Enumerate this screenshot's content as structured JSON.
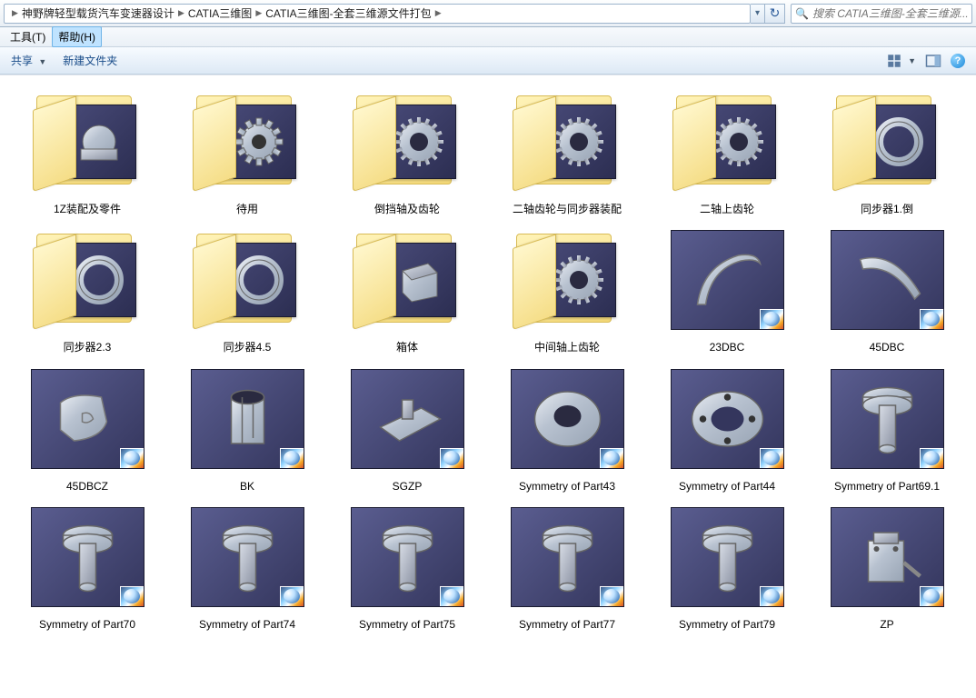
{
  "breadcrumb": {
    "seg1": "神野牌轻型载货汽车变速器设计",
    "seg2": "CATIA三维图",
    "seg3": "CATIA三维图-全套三维源文件打包"
  },
  "search": {
    "placeholder": "搜索 CATIA三维图-全套三维源..."
  },
  "menu": {
    "tools": "工具(T)",
    "help": "帮助(H)"
  },
  "toolbar": {
    "share": "共享",
    "newfolder": "新建文件夹"
  },
  "items": [
    {
      "name": "1Z装配及零件",
      "type": "folder",
      "shape": "assembly"
    },
    {
      "name": "待用",
      "type": "folder",
      "shape": "gear"
    },
    {
      "name": "倒挡轴及齿轮",
      "type": "folder",
      "shape": "gear2"
    },
    {
      "name": "二轴齿轮与同步器装配",
      "type": "folder",
      "shape": "gear2"
    },
    {
      "name": "二轴上齿轮",
      "type": "folder",
      "shape": "gear2"
    },
    {
      "name": "同步器1.倒",
      "type": "folder",
      "shape": "ring"
    },
    {
      "name": "同步器2.3",
      "type": "folder",
      "shape": "ring"
    },
    {
      "name": "同步器4.5",
      "type": "folder",
      "shape": "ring"
    },
    {
      "name": "箱体",
      "type": "folder",
      "shape": "box"
    },
    {
      "name": "中间轴上齿轮",
      "type": "folder",
      "shape": "gear2"
    },
    {
      "name": "23DBC",
      "type": "file",
      "shape": "fork"
    },
    {
      "name": "45DBC",
      "type": "file",
      "shape": "fork2"
    },
    {
      "name": "45DBCZ",
      "type": "file",
      "shape": "bracket"
    },
    {
      "name": "BK",
      "type": "file",
      "shape": "cylinder_open"
    },
    {
      "name": "SGZP",
      "type": "file",
      "shape": "plate"
    },
    {
      "name": "Symmetry of Part43",
      "type": "file",
      "shape": "flange_solid"
    },
    {
      "name": "Symmetry of Part44",
      "type": "file",
      "shape": "flange_flat"
    },
    {
      "name": "Symmetry of Part69.1",
      "type": "file",
      "shape": "bolt"
    },
    {
      "name": "Symmetry of Part70",
      "type": "file",
      "shape": "bolt"
    },
    {
      "name": "Symmetry of Part74",
      "type": "file",
      "shape": "bolt"
    },
    {
      "name": "Symmetry of Part75",
      "type": "file",
      "shape": "bolt"
    },
    {
      "name": "Symmetry of Part77",
      "type": "file",
      "shape": "bolt"
    },
    {
      "name": "Symmetry of Part79",
      "type": "file",
      "shape": "bolt"
    },
    {
      "name": "ZP",
      "type": "file",
      "shape": "assembly2"
    }
  ]
}
